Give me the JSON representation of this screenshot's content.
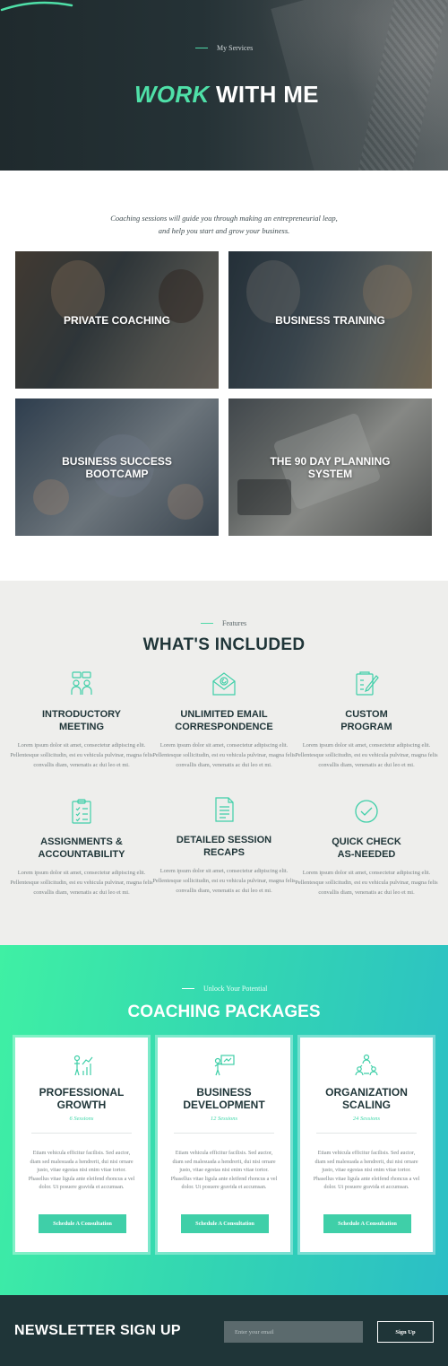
{
  "hero": {
    "eyebrow": "My Services",
    "title_accent": "WORK",
    "title_rest": " WITH ME"
  },
  "services": {
    "intro_line1": "Coaching sessions will guide you through making an entrepreneurial leap,",
    "intro_line2": "and help you start and grow your business.",
    "cards": [
      {
        "label": "PRIVATE COACHING"
      },
      {
        "label": "BUSINESS TRAINING"
      },
      {
        "label_line1": "BUSINESS SUCCESS",
        "label_line2": "BOOTCAMP"
      },
      {
        "label_line1": "THE 90 DAY PLANNING",
        "label_line2": "SYSTEM"
      }
    ]
  },
  "included": {
    "eyebrow": "Features",
    "title": "WHAT'S INCLUDED",
    "features": [
      {
        "icon": "meeting-icon",
        "line1": "INTRODUCTORY",
        "line2": "MEETING",
        "desc": "Lorem ipsum dolor sit amet, consectetur adipiscing elit. Pellentesque sollicitudin, est eu vehicula pulvinar, magna felis convallis diam, venenatis ac dui leo et mi."
      },
      {
        "icon": "email-icon",
        "line1": "UNLIMITED EMAIL",
        "line2": "CORRESPONDENCE",
        "desc": "Lorem ipsum dolor sit amet, consectetur adipiscing elit. Pellentesque sollicitudin, est eu vehicula pulvinar, magna felis convallis diam, venenatis ac dui leo et mi."
      },
      {
        "icon": "program-icon",
        "line1": "CUSTOM",
        "line2": "PROGRAM",
        "desc": "Lorem ipsum dolor sit amet, consectetur adipiscing elit. Pellentesque sollicitudin, est eu vehicula pulvinar, magna felis convallis diam, venenatis ac dui leo et mi."
      },
      {
        "icon": "clipboard-icon",
        "line1": "ASSIGNMENTS &",
        "line2": "ACCOUNTABILITY",
        "desc": "Lorem ipsum dolor sit amet, consectetur adipiscing elit. Pellentesque sollicitudin, est eu vehicula pulvinar, magna felis convallis diam, venenatis ac dui leo et mi."
      },
      {
        "icon": "document-icon",
        "line1": "DETAILED SESSION",
        "line2": "RECAPS",
        "desc": "Lorem ipsum dolor sit amet, consectetur adipiscing elit. Pellentesque sollicitudin, est eu vehicula pulvinar, magna felis convallis diam, venenatis ac dui leo et mi."
      },
      {
        "icon": "check-circle-icon",
        "line1": "QUICK CHECK",
        "line2": "AS-NEEDED",
        "desc": "Lorem ipsum dolor sit amet, consectetur adipiscing elit. Pellentesque sollicitudin, est eu vehicula pulvinar, magna felis convallis diam, venenatis ac dui leo et mi."
      }
    ]
  },
  "packages": {
    "eyebrow": "Unlock Your Potential",
    "title": "COACHING PACKAGES",
    "items": [
      {
        "icon": "growth-icon",
        "line1": "PROFESSIONAL",
        "line2": "GROWTH",
        "sessions": "6 Sessions",
        "desc": "Etiam vehicula efficitur facilisis. Sed auctor, diam sed malesuada a hendrerit, dui nisi ornare justo, vitae egestas nisi enim vitae tortor. Phasellus vitae ligula ante eleifend rhoncus a vel dolor. Ut posuere gravida et accumsan.",
        "button": "Schedule A Consultation"
      },
      {
        "icon": "presentation-icon",
        "line1": "BUSINESS",
        "line2": "DEVELOPMENT",
        "sessions": "12 Sessions",
        "desc": "Etiam vehicula efficitur facilisis. Sed auctor, diam sed malesuada a hendrerit, dui nisi ornare justo, vitae egestas nisi enim vitae tortor. Phasellus vitae ligula ante eleifend rhoncus a vel dolor. Ut posuere gravida et accumsan.",
        "button": "Schedule A Consultation"
      },
      {
        "icon": "team-network-icon",
        "line1": "ORGANIZATION",
        "line2": "SCALING",
        "sessions": "24 Sessions",
        "desc": "Etiam vehicula efficitur facilisis. Sed auctor, diam sed malesuada a hendrerit, dui nisi ornare justo, vitae egestas nisi enim vitae tortor. Phasellus vitae ligula ante eleifend rhoncus a vel dolor. Ut posuere gravida et accumsan.",
        "button": "Schedule A Consultation"
      }
    ]
  },
  "newsletter": {
    "title": "NEWSLETTER SIGN UP",
    "placeholder": "Enter your email",
    "button": "Sign Up"
  },
  "colors": {
    "accent": "#4fe0a8",
    "dark": "#1f3538",
    "button": "#3fcfa8",
    "gradient_start": "#3ff0a4",
    "gradient_end": "#2bbec6"
  }
}
